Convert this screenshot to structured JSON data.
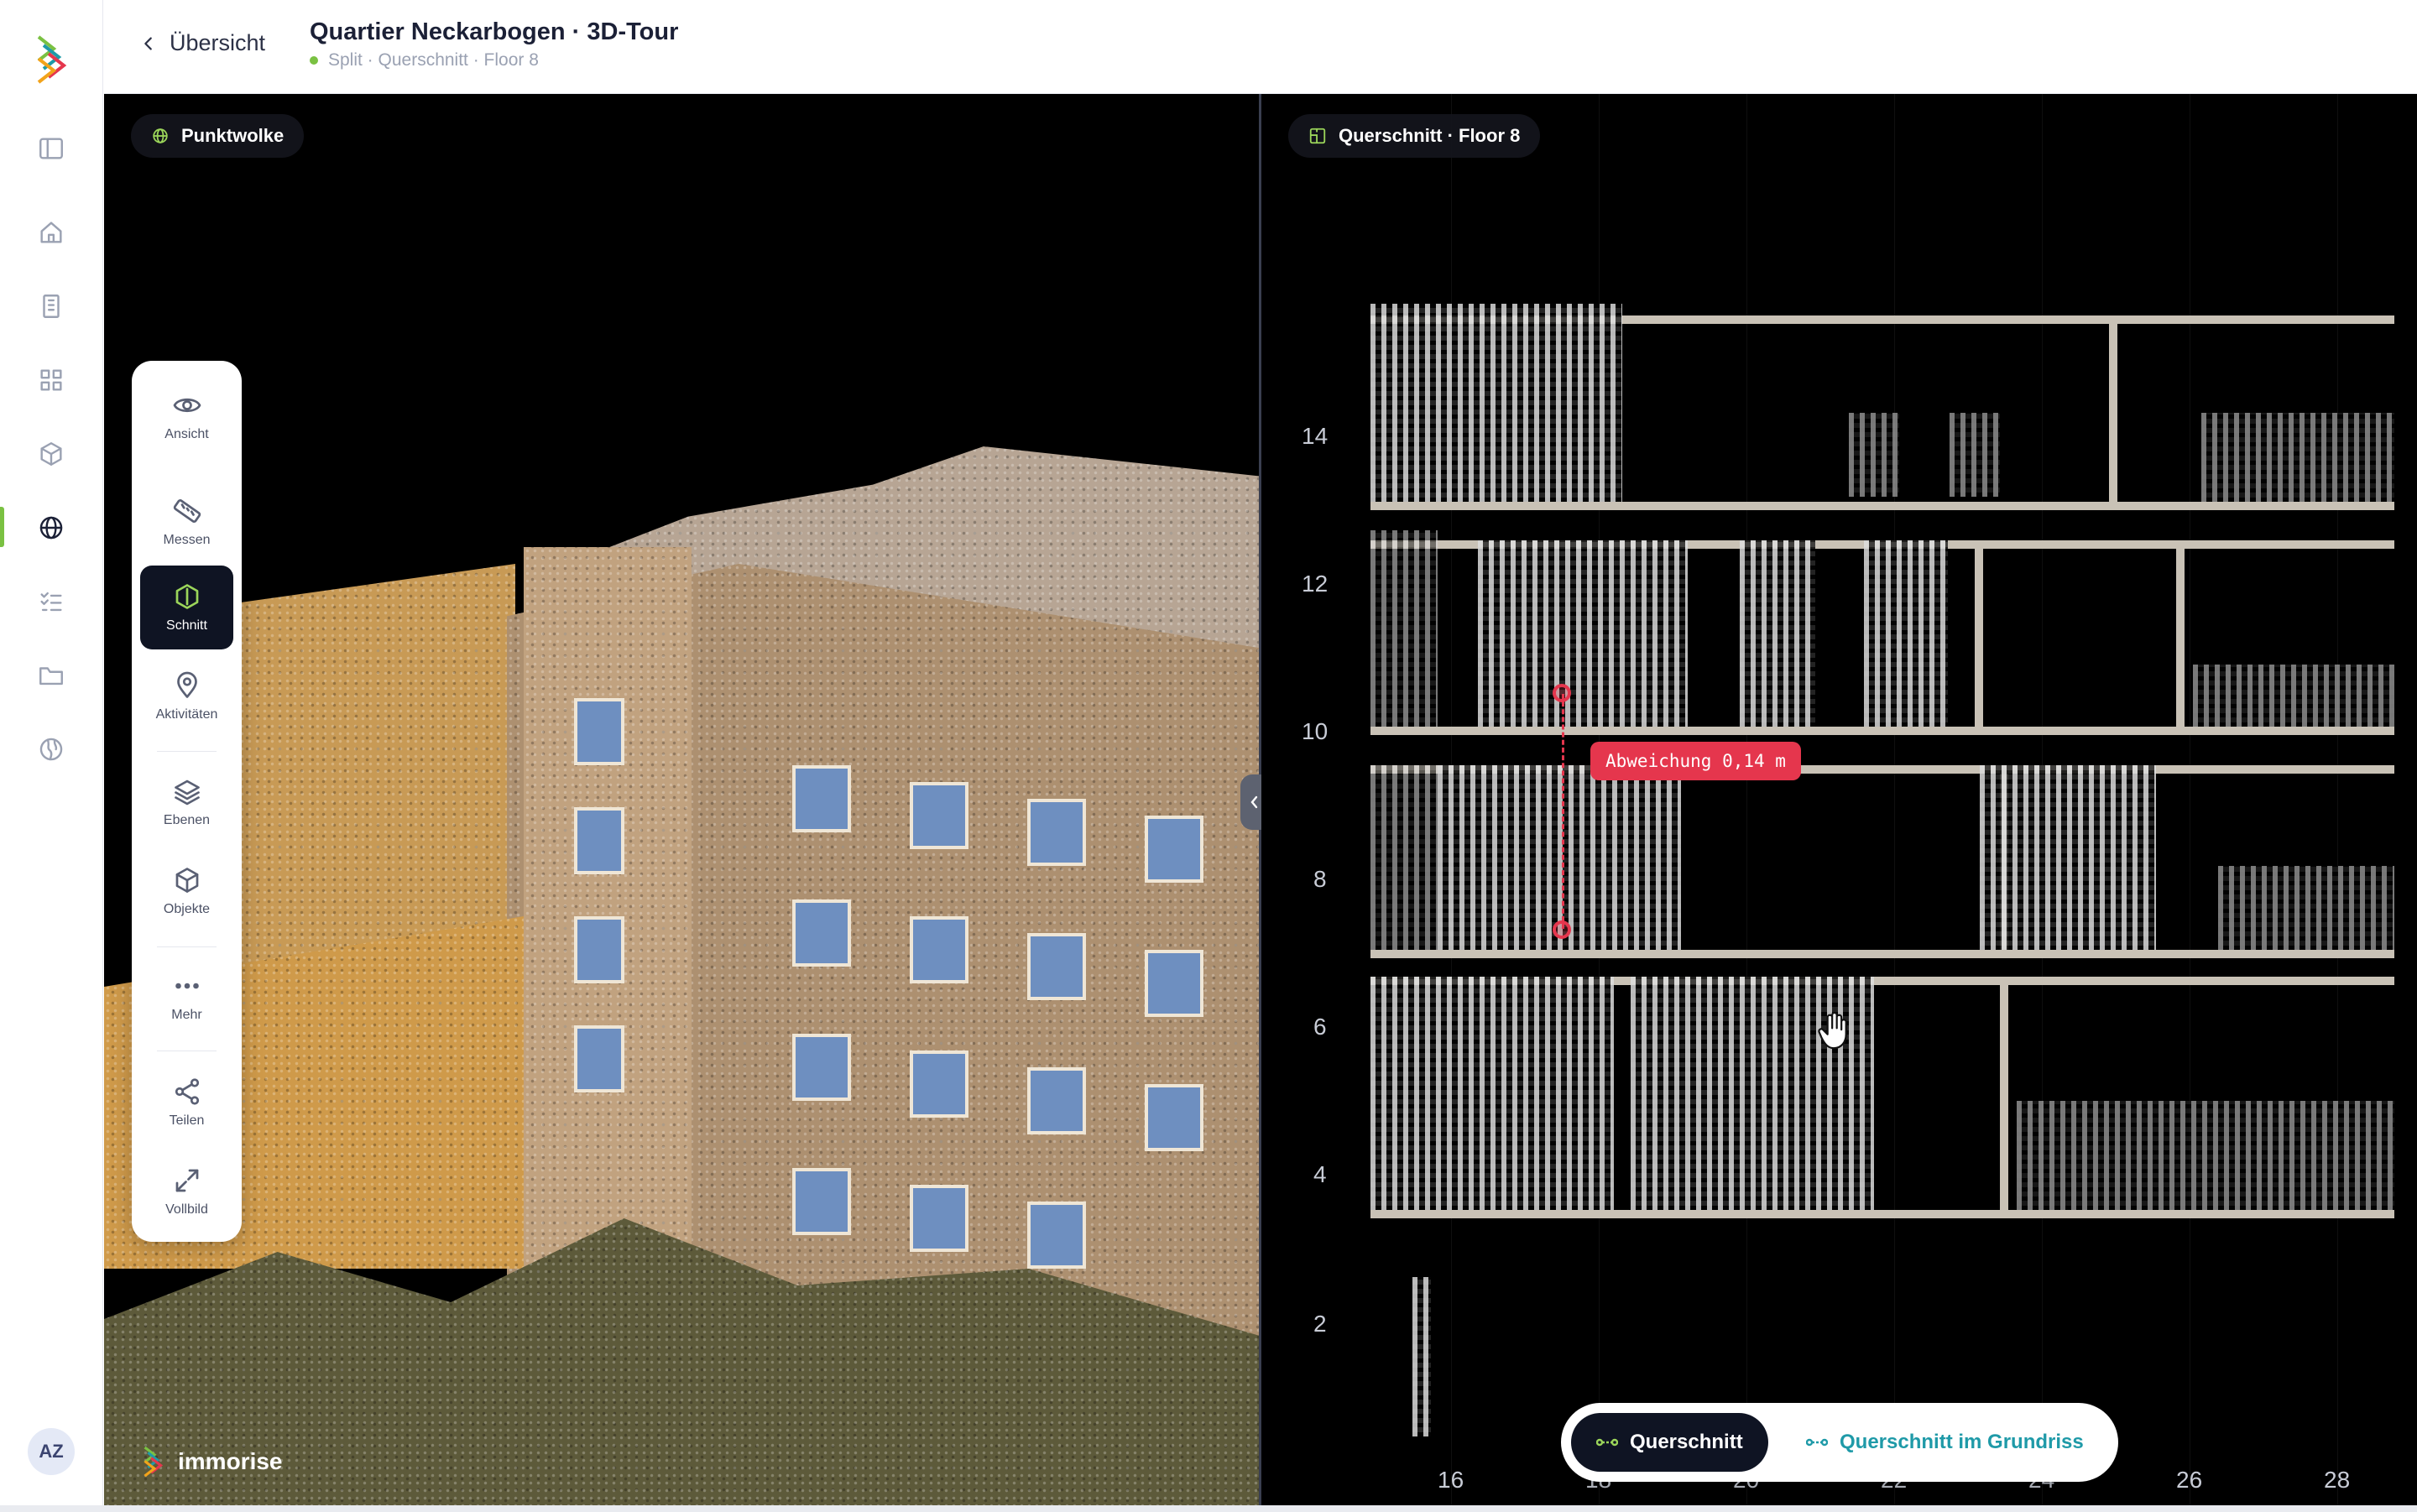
{
  "header": {
    "back_label": "Übersicht",
    "title": "Quartier Neckarbogen · 3D-Tour",
    "subtitle": "Split · Querschnitt · Floor 8"
  },
  "user": {
    "initials": "AZ"
  },
  "left_view": {
    "chip_label": "Punktwolke"
  },
  "right_view": {
    "chip_label": "Querschnitt · Floor 8",
    "deviation_label": "Abweichung 0,14 m",
    "y_ticks": [
      "14",
      "12",
      "10",
      "8",
      "6",
      "4",
      "2"
    ],
    "x_ticks": [
      "16",
      "18",
      "20",
      "22",
      "24",
      "26",
      "28"
    ]
  },
  "tools": [
    {
      "label": "Ansicht",
      "icon": "eye-icon"
    },
    {
      "label": "Messen",
      "icon": "ruler-icon"
    },
    {
      "label": "Schnitt",
      "icon": "section-cube-icon",
      "active": true
    },
    {
      "label": "Aktivitäten",
      "icon": "map-pin-icon"
    },
    {
      "label": "Ebenen",
      "icon": "layers-icon"
    },
    {
      "label": "Objekte",
      "icon": "cube-icon"
    },
    {
      "label": "Mehr",
      "icon": "more-dots-icon"
    },
    {
      "label": "Teilen",
      "icon": "share-icon"
    },
    {
      "label": "Vollbild",
      "icon": "fullscreen-icon"
    }
  ],
  "brand": {
    "name": "immorise"
  },
  "mode_toggle": {
    "option_a": "Querschnitt",
    "option_b": "Querschnitt im Grundriss",
    "selected": "Querschnitt"
  },
  "colors": {
    "accent": "#7ac142",
    "alert": "#e5364d",
    "teal": "#1f9aa8",
    "dark": "#0f1423"
  }
}
